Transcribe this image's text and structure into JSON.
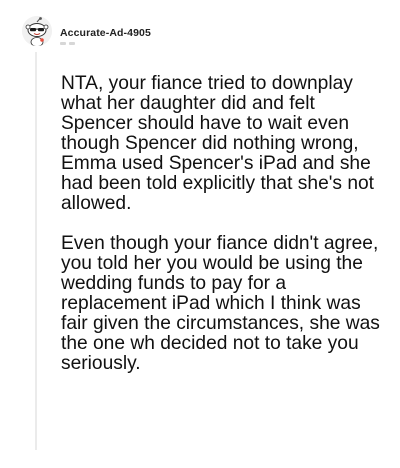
{
  "comment": {
    "author": "Accurate-Ad-4905",
    "avatar_icon": "snoo-avatar-icon",
    "paragraphs": [
      "NTA, your fiance tried to downplay what her daughter did and felt Spencer should have to wait even though Spencer did nothing wrong, Emma used Spencer's iPad and she had been told explicitly that she's not allowed.",
      "Even though your fiance didn't agree, you told her you would be using the wedding funds to pay for a replacement iPad which I think was fair given the circumstances, she was the one wh decided not to take you seriously."
    ]
  }
}
